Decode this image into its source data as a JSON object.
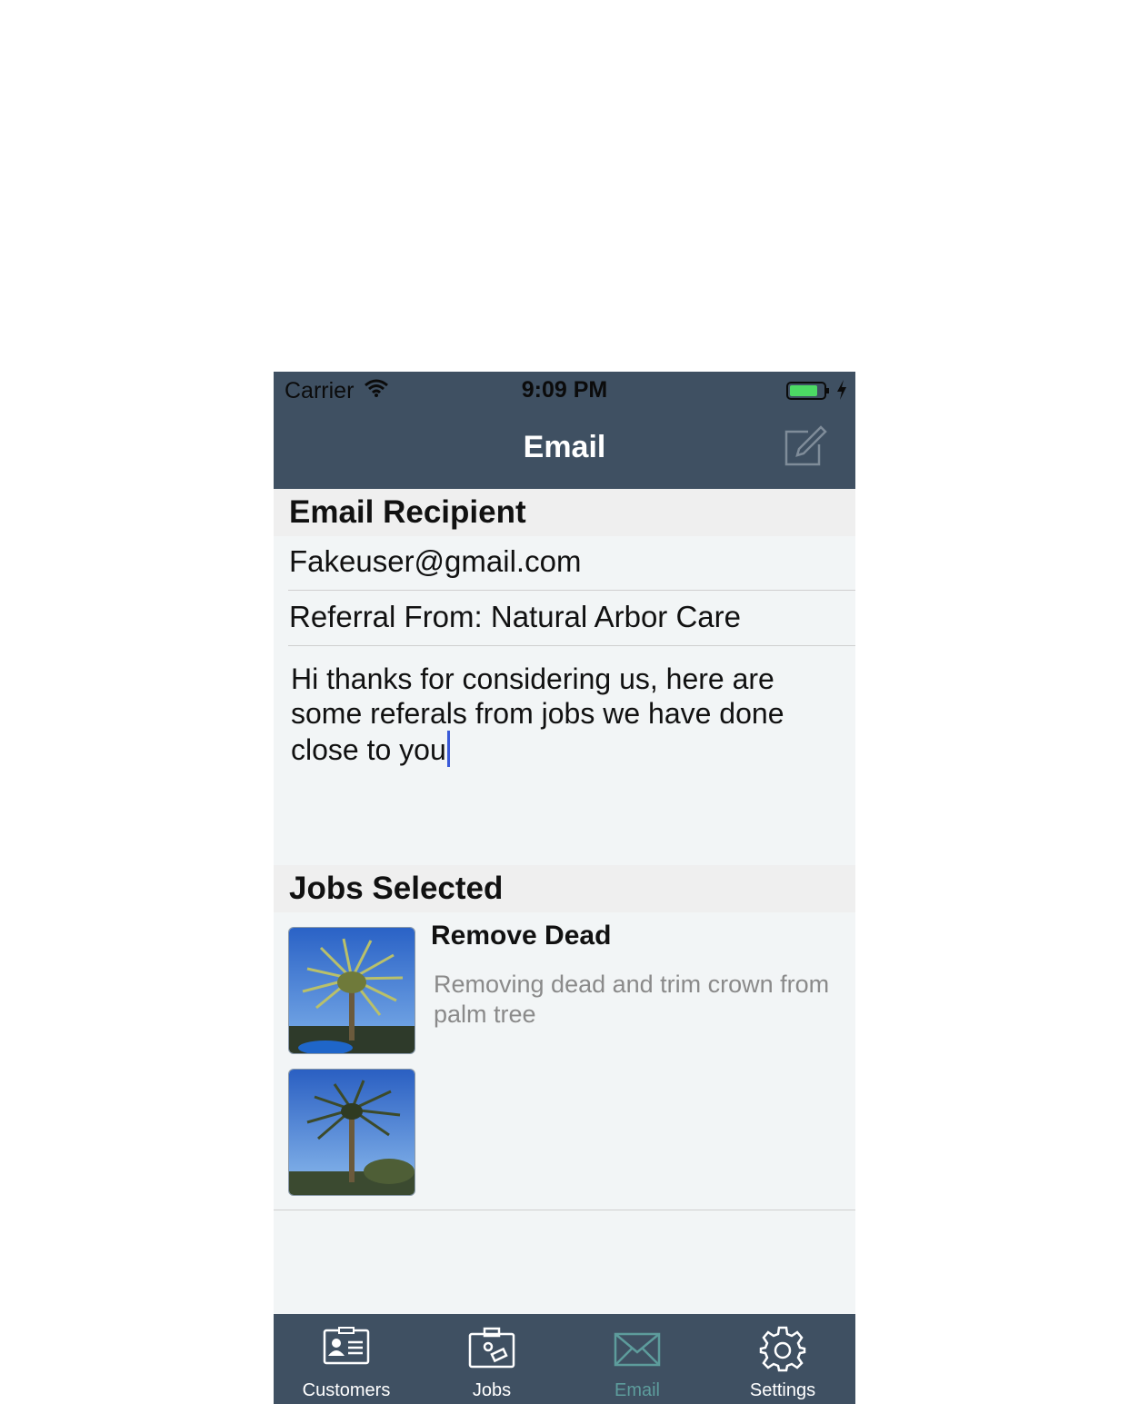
{
  "status_bar": {
    "carrier": "Carrier",
    "time": "9:09 PM"
  },
  "nav": {
    "title": "Email",
    "compose_icon": "compose-icon"
  },
  "recipient_section": {
    "header": "Email Recipient"
  },
  "email_field": {
    "value": "Fakeuser@gmail.com"
  },
  "subject_field": {
    "value": "Referral From: Natural Arbor Care"
  },
  "message": {
    "value": "Hi thanks for considering us, here are some referals from jobs we have done close to you"
  },
  "jobs_section": {
    "header": "Jobs Selected"
  },
  "jobs": [
    {
      "title": "Remove Dead",
      "description": "Removing dead and trim crown from palm tree"
    }
  ],
  "tab_bar": {
    "items": [
      {
        "label": "Customers",
        "icon": "id-card-icon"
      },
      {
        "label": "Jobs",
        "icon": "briefcase-icon"
      },
      {
        "label": "Email",
        "icon": "envelope-icon",
        "active": true
      },
      {
        "label": "Settings",
        "icon": "gear-icon"
      }
    ]
  },
  "colors": {
    "bar": "#3f5062",
    "active_tab": "#5d9c9c",
    "caret": "#3a5ad8",
    "battery": "#4cd964"
  }
}
